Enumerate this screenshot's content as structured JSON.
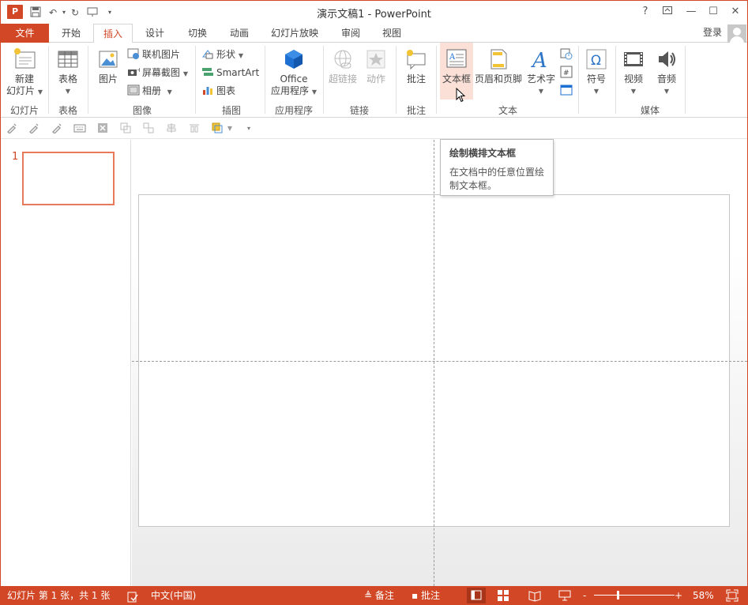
{
  "app": {
    "icon_letter": "P",
    "title": "演示文稿1 - PowerPoint",
    "brand_color": "#d24726"
  },
  "window_controls": {
    "help": "?",
    "ribbon_options": "⊡",
    "minimize": "—",
    "maximize": "☐",
    "close": "✕"
  },
  "tabs": {
    "file": "文件",
    "items": [
      "开始",
      "插入",
      "设计",
      "切换",
      "动画",
      "幻灯片放映",
      "审阅",
      "视图"
    ],
    "active": "插入",
    "signin": "登录"
  },
  "ribbon": {
    "groups": {
      "slides": {
        "label": "幻灯片",
        "new_slide_line1": "新建",
        "new_slide_line2": "幻灯片"
      },
      "tables": {
        "label": "表格",
        "table": "表格"
      },
      "images": {
        "label": "图像",
        "picture": "图片",
        "online_pictures": "联机图片",
        "screenshot": "屏幕截图",
        "album": "相册"
      },
      "illustrations": {
        "label": "插图",
        "shapes": "形状",
        "smartart": "SmartArt",
        "chart": "图表"
      },
      "apps": {
        "label": "应用程序",
        "office_line1": "Office",
        "office_line2": "应用程序"
      },
      "links": {
        "label": "链接",
        "hyperlink": "超链接",
        "action": "动作"
      },
      "comments": {
        "label": "批注",
        "comment": "批注"
      },
      "text": {
        "label": "文本",
        "textbox": "文本框",
        "header_footer": "页眉和页脚",
        "wordart": "艺术字"
      },
      "symbols": {
        "symbol": "符号"
      },
      "media": {
        "label": "媒体",
        "video": "视频",
        "audio": "音频"
      }
    }
  },
  "tooltip": {
    "title": "绘制横排文本框",
    "description": "在文档中的任意位置绘制文本框。"
  },
  "thumbnails": {
    "slide_number": "1"
  },
  "statusbar": {
    "slide_info": "幻灯片 第 1 张，共 1 张",
    "language": "中文(中国)",
    "notes": "备注",
    "comments": "批注",
    "zoom": "58%",
    "zoom_minus": "-",
    "zoom_plus": "+"
  },
  "zoom_level_fraction": 0.58
}
